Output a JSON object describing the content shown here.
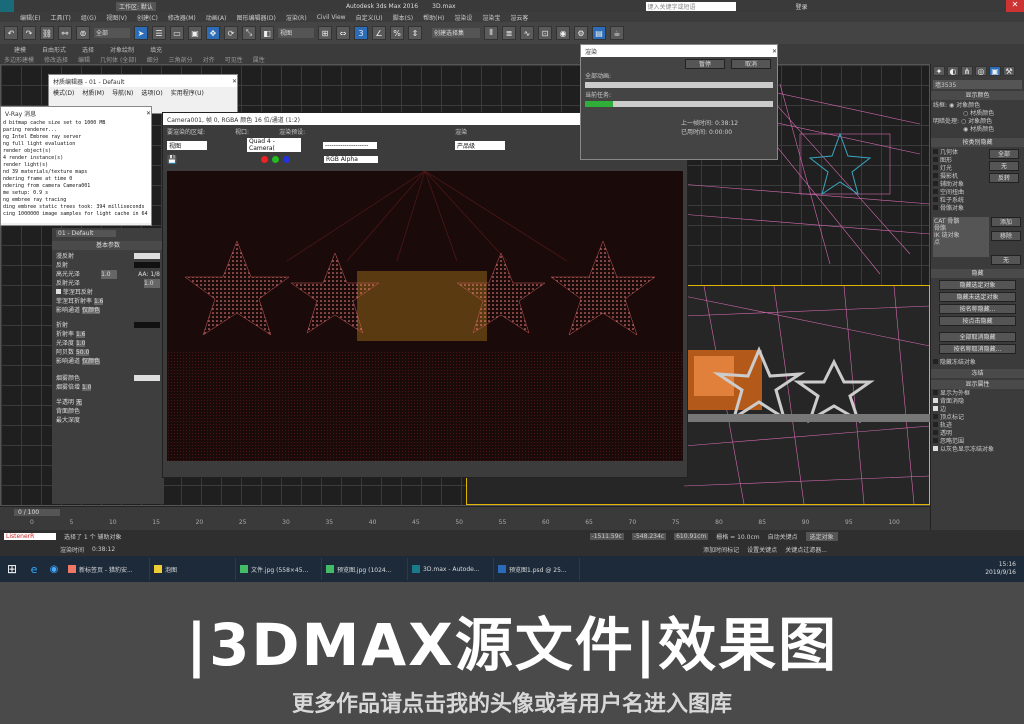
{
  "app": {
    "title": "Autodesk 3ds Max 2016",
    "file": "3D.max",
    "workspace_label": "工作区: 默认",
    "search_placeholder": "键入关键字或短语",
    "login": "登录"
  },
  "menu": [
    "编辑(E)",
    "工具(T)",
    "组(G)",
    "视图(V)",
    "创建(C)",
    "修改器(M)",
    "动画(A)",
    "图形编辑器(D)",
    "渲染(R)",
    "Civil View",
    "自定义(U)",
    "脚本(S)",
    "帮助(H)",
    "渲染设",
    "渲染宝",
    "渲云客"
  ],
  "toolbar": {
    "filter": "全部",
    "viewport_dd": "视图",
    "selection_set": "创建选择集"
  },
  "ribbon": {
    "tabs": [
      "建模",
      "自由形式",
      "选择",
      "对象绘制",
      "填充"
    ],
    "sub": [
      "多边形建模",
      "修改选择",
      "编辑",
      "几何体 (全部)",
      "细分",
      "三角剖分",
      "对齐",
      "可见性",
      "属性"
    ]
  },
  "material_editor": {
    "title": "材质编辑器 - 01 - Default",
    "menu": [
      "模式(D)",
      "材质(M)",
      "导航(N)",
      "选项(O)",
      "实用程序(U)"
    ]
  },
  "vray_log": {
    "title": "V-Ray 消息",
    "lines": [
      "d bitmap cache size set to 1000 MB",
      "paring renderer...",
      "ng Intel Embree ray server",
      "ng full light evaluation",
      "render object(s)",
      "4 render instance(s)",
      "render light(s)",
      "nd 39 materials/texture maps",
      "ndering frame at time 0",
      "ndering from camera Camera001",
      "me setup: 0.9 s",
      "ng embree ray tracing",
      "ding embree static trees took: 394 milliseconds",
      "cing 1000000 image samples for light cache in 64 passes"
    ]
  },
  "render_window": {
    "title": "Camera001, 帧 0, RGBA 颜色 16 位/通道 (1:2)",
    "area_label": "要渲染的区域:",
    "area_value": "视图",
    "viewport_label": "视口:",
    "viewport_value": "Quad 4 - Camera(",
    "preset_label": "渲染预设:",
    "preset_value": "--------------------",
    "render_button": "渲染",
    "product_value": "产品级",
    "channel_value": "RGB Alpha"
  },
  "progress": {
    "title": "渲染",
    "pause": "暂停",
    "cancel": "取消",
    "total_label": "全部动画:",
    "current_label": "当前任务:",
    "task_fill": 0.15,
    "elapsed_label": "上一帧时间:",
    "elapsed_value": "0:38:12",
    "used_label": "已用时间:",
    "used_value": "0:00:00"
  },
  "material_params": {
    "header": "基本参数",
    "diffuse": "漫反射",
    "reflect": "反射",
    "gloss": "高光光泽",
    "gloss_val": "1.0",
    "refl_gloss": "反射光泽",
    "refl_gloss_val": "1.0",
    "fresnel": "菲涅耳反射",
    "fresnel_ior": "菲涅耳折射率",
    "fresnel_ior_val": "1.6",
    "affect": "影响通道",
    "affect_val": "仅颜色",
    "refract": "折射",
    "ior": "折射率",
    "ior_val": "1.6",
    "refract_gloss": "光泽度",
    "refract_gloss_val": "1.0",
    "abbe": "阿贝数",
    "abbe_val": "50.0",
    "fog": "烟雾颜色",
    "fog_mult": "烟雾倍增",
    "fog_mult_val": "1.0",
    "opacity": "半透明",
    "opacity_val": "无",
    "aa": "AA: 1/8",
    "mat_name": "01 - Default",
    "backlight": "背面颜色",
    "max_depth": "最大深度"
  },
  "right_panel": {
    "object_name": "墙3535",
    "display_color": "显示颜色",
    "wireframe": "线框:",
    "shaded": "明暗处理:",
    "obj_color": "对象颜色",
    "mat_color": "材质颜色",
    "hide_by_cat": "按类别隐藏",
    "cats": [
      "几何体",
      "图形",
      "灯光",
      "摄影机",
      "辅助对象",
      "空间扭曲",
      "粒子系统",
      "骨骼对象"
    ],
    "all": "全部",
    "none": "无",
    "invert": "反转",
    "cat_list": [
      "CAT 骨骼",
      "骨骼",
      "IK 链对象",
      "点"
    ],
    "add": "添加",
    "remove": "移除",
    "hide": "隐藏",
    "hide_btns": [
      "隐藏选定对象",
      "隐藏未选定对象",
      "按名称隐藏...",
      "按点击隐藏"
    ],
    "unhide_btns": [
      "全部取消隐藏",
      "按名称取消隐藏..."
    ],
    "hide_frozen": "隐藏冻结对象",
    "freeze": "冻结",
    "display_props": "显示属性",
    "props": [
      "显示为外框",
      "背面消隐",
      "边",
      "顶点标记",
      "轨迹",
      "透明",
      "忽略范围",
      "以灰色显示冻结对象"
    ]
  },
  "timeline": {
    "frame": "0 / 100",
    "ticks": [
      "0",
      "5",
      "10",
      "15",
      "20",
      "25",
      "30",
      "35",
      "40",
      "45",
      "50",
      "55",
      "60",
      "65",
      "70",
      "75",
      "80",
      "85",
      "90",
      "95",
      "100"
    ]
  },
  "status": {
    "selected": "选择了 1 个 辅助对象",
    "render_time_label": "渲染时间",
    "render_time": "0:38:12",
    "x": "-1511.59c",
    "y": "-548.234c",
    "z": "610.91cm",
    "grid": "栅格 = 10.0cm",
    "auto_key": "自动关键点",
    "selected_obj": "选定对象",
    "set_key": "设置关键点",
    "key_filter": "关键点过滤器...",
    "add_time_tag": "添加时间标记",
    "script_label": "ListenerR"
  },
  "taskbar": {
    "items": [
      "新标签页 - 猎豹安...",
      "泡图",
      "文件.jpg (558×45...",
      "预览图.jpg (1024...",
      "3D.max - Autode...",
      "预览图1.psd @ 25..."
    ],
    "time": "15:16",
    "date": "2019/9/16"
  },
  "banner": {
    "title": "|3DMAX源文件|效果图",
    "subtitle": "更多作品请点击我的头像或者用户名进入图库"
  },
  "colors": {
    "accent": "#2d6db8",
    "banner_bg": "#4a4a4a",
    "progress_green": "#2fae3a"
  }
}
